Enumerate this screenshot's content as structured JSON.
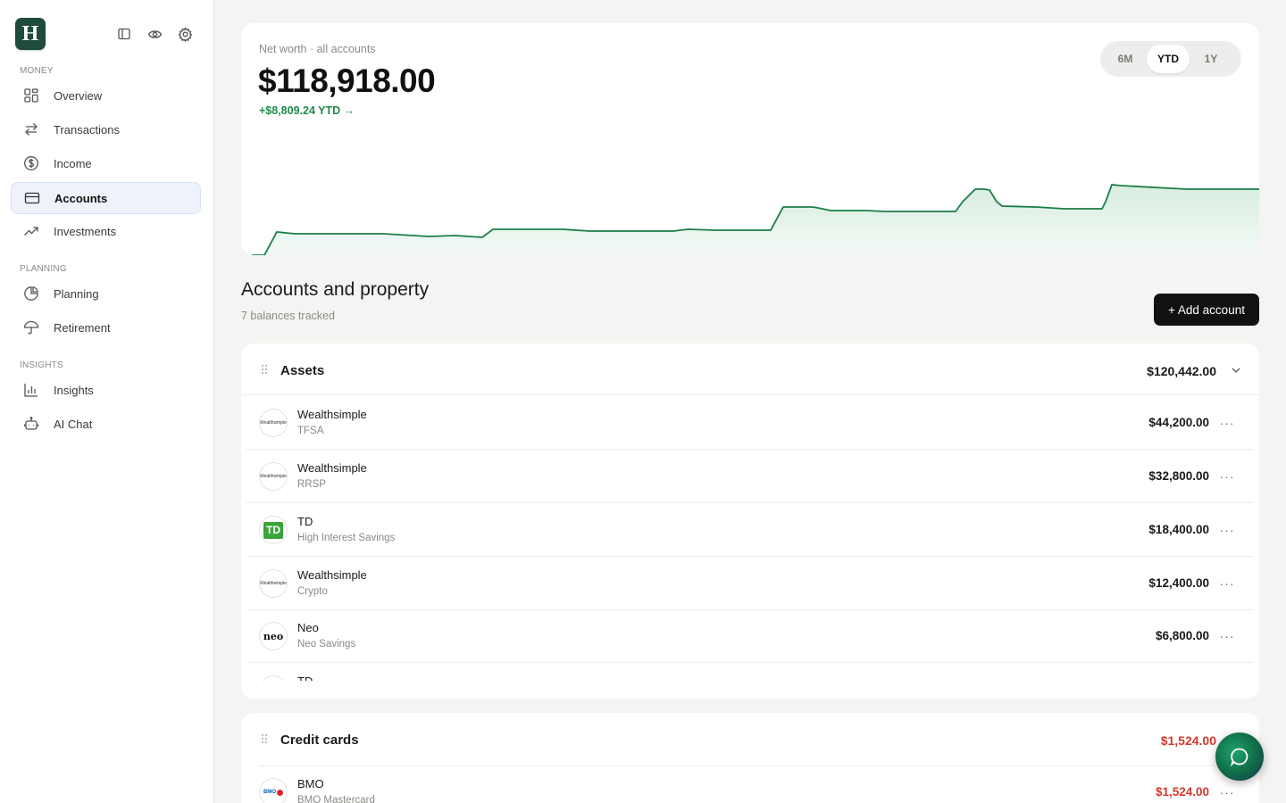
{
  "app": {
    "logo_letter": "H"
  },
  "sidebar": {
    "sections": [
      {
        "label": "MONEY"
      },
      {
        "label": "PLANNING"
      },
      {
        "label": "INSIGHTS"
      }
    ],
    "items": [
      {
        "label": "Overview",
        "icon": "grid-icon"
      },
      {
        "label": "Transactions",
        "icon": "arrows-swap-icon"
      },
      {
        "label": "Income",
        "icon": "dollar-circle-icon"
      },
      {
        "label": "Accounts",
        "icon": "credit-card-icon",
        "active": true
      },
      {
        "label": "Investments",
        "icon": "trending-up-icon"
      },
      {
        "label": "Planning",
        "icon": "pie-chart-icon"
      },
      {
        "label": "Retirement",
        "icon": "umbrella-icon"
      },
      {
        "label": "Insights",
        "icon": "bar-chart-icon"
      },
      {
        "label": "AI Chat",
        "icon": "robot-icon"
      }
    ]
  },
  "networth": {
    "label": "Net worth · all accounts",
    "value": "$118,918.00",
    "change": "+$8,809.24 YTD →",
    "ranges": [
      "6M",
      "YTD",
      "1Y"
    ],
    "selected_range": "YTD",
    "line_color": "#1a7f45"
  },
  "accounts": {
    "title": "Accounts and property",
    "subtitle": "7 balances tracked",
    "add_button": "+ Add account",
    "assets": {
      "name": "Assets",
      "total": "$120,442.00",
      "rows": [
        {
          "institution": "Wealthsimple",
          "account": "TFSA",
          "amount": "$44,200.00",
          "logo": "Wealthsimple"
        },
        {
          "institution": "Wealthsimple",
          "account": "RRSP",
          "amount": "$32,800.00",
          "logo": "Wealthsimple"
        },
        {
          "institution": "TD",
          "account": "High Interest Savings",
          "amount": "$18,400.00",
          "logo": "TD"
        },
        {
          "institution": "Wealthsimple",
          "account": "Crypto",
          "amount": "$12,400.00",
          "logo": "Wealthsimple"
        },
        {
          "institution": "Neo",
          "account": "Neo Savings",
          "amount": "$6,800.00",
          "logo": "neo"
        },
        {
          "institution": "TD",
          "account": "",
          "amount": "",
          "logo": ""
        }
      ]
    },
    "credit": {
      "name": "Credit cards",
      "total": "$1,524.00",
      "rows": [
        {
          "institution": "BMO",
          "account": "BMO Mastercard",
          "amount": "$1,524.00",
          "logo": "BMO"
        }
      ]
    }
  }
}
